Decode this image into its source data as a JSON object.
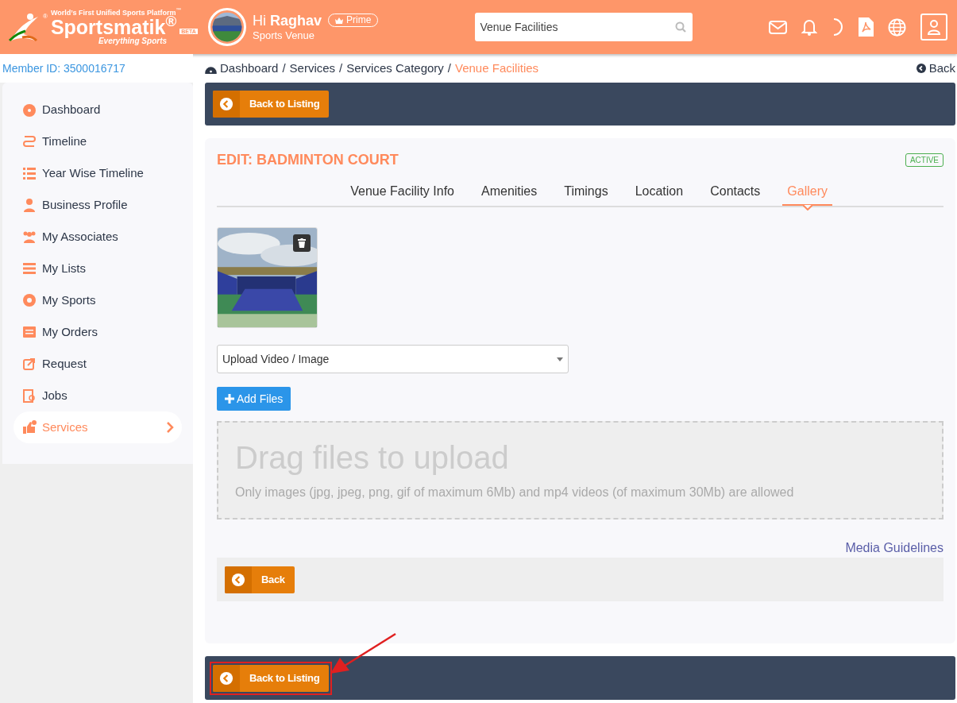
{
  "header": {
    "logo": {
      "mark": "®",
      "tagline": "World’s First Unified Sports Platform$^{™}$",
      "name": "Sportsmatik$^{®}$",
      "badge": "BETA",
      "slogan": "Everything Sports"
    },
    "user": {
      "greeting": "Hi",
      "name": "Raghav",
      "badge": "Prime",
      "role": "Sports Venue"
    },
    "search": {
      "value": "Venue Facilities"
    }
  },
  "member_id": "Member ID: 3500016717",
  "breadcrumb": {
    "separator": "/",
    "items": [
      {
        "label": "Dashboard",
        "current": false
      },
      {
        "label": "Services",
        "current": false
      },
      {
        "label": "Services Category",
        "current": false
      },
      {
        "label": "Venue Facilities",
        "current": true
      }
    ]
  },
  "back_link": "Back",
  "sidebar": {
    "items": [
      {
        "label": "Dashboard",
        "selected": false
      },
      {
        "label": "Timeline",
        "selected": false
      },
      {
        "label": "Year Wise Timeline",
        "selected": false
      },
      {
        "label": "Business Profile",
        "selected": false
      },
      {
        "label": "My Associates",
        "selected": false
      },
      {
        "label": "My Lists",
        "selected": false
      },
      {
        "label": "My Sports",
        "selected": false
      },
      {
        "label": "My Orders",
        "selected": false
      },
      {
        "label": "Request",
        "selected": false
      },
      {
        "label": "Jobs",
        "selected": false
      },
      {
        "label": "Services",
        "selected": true
      }
    ]
  },
  "top_bar": {
    "button": "Back to Listing"
  },
  "card": {
    "title": "EDIT: BADMINTON COURT",
    "status": "ACTIVE",
    "tabs": [
      {
        "label": "Venue Facility Info",
        "selected": false
      },
      {
        "label": "Amenities",
        "selected": false
      },
      {
        "label": "Timings",
        "selected": false
      },
      {
        "label": "Location",
        "selected": false
      },
      {
        "label": "Contacts",
        "selected": false
      },
      {
        "label": "Gallery",
        "selected": true
      }
    ],
    "upload_select": "Upload Video / Image",
    "add_button": "Add Files",
    "dropzone": {
      "title": "Drag files to upload",
      "hint": "Only images (jpg, jpeg, png, gif of maximum 6Mb) and mp4 videos (of maximum 30Mb) are allowed"
    },
    "media_link": "Media Guidelines",
    "back_button": "Back"
  },
  "bottom_bar": {
    "button": "Back to Listing",
    "highlighted": true
  }
}
